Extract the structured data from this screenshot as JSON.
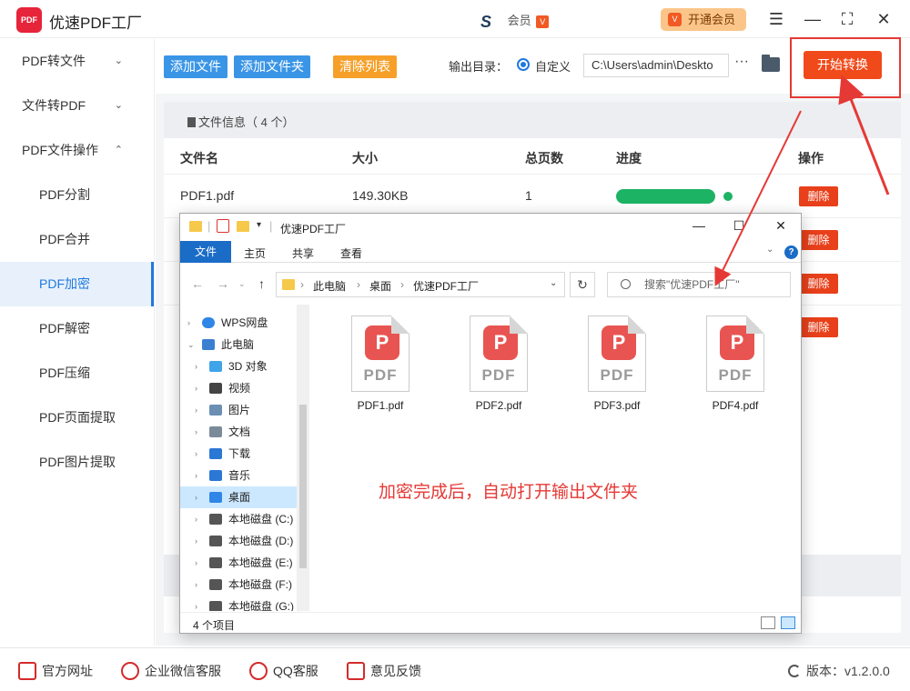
{
  "app": {
    "title": "优速PDF工厂",
    "logo_text": "PDF",
    "account_text": "会员",
    "account_badge": "V",
    "vip_button": "开通会员",
    "vip_icon": "V"
  },
  "window_controls": {
    "menu": "☰",
    "minimize": "—",
    "maximize": "⛶",
    "close": "✕"
  },
  "sidebar": {
    "items": [
      {
        "label": "PDF转文件",
        "chevron": "⌄"
      },
      {
        "label": "文件转PDF",
        "chevron": "⌄"
      },
      {
        "label": "PDF文件操作",
        "chevron": "⌃"
      }
    ],
    "sub_items": [
      "PDF分割",
      "PDF合并",
      "PDF加密",
      "PDF解密",
      "PDF压缩",
      "PDF页面提取",
      "PDF图片提取"
    ],
    "active": "PDF加密"
  },
  "toolbar": {
    "add_file": "添加文件",
    "add_folder": "添加文件夹",
    "clear_list": "清除列表",
    "output_label": "输出目录：",
    "radio_label": "自定义",
    "output_path": "C:\\Users\\admin\\Deskto",
    "more": "···",
    "start_button": "开始转换"
  },
  "file_info": {
    "label": "文件信息（ 4 个）"
  },
  "table": {
    "headers": [
      "文件名",
      "大小",
      "总页数",
      "进度",
      "操作"
    ],
    "rows": [
      {
        "name": "PDF1.pdf",
        "size": "149.30KB",
        "pages": "1",
        "progress": 1.0,
        "action": "删除"
      },
      {
        "name": "",
        "size": "",
        "pages": "",
        "progress": null,
        "action": "删除"
      },
      {
        "name": "",
        "size": "",
        "pages": "",
        "progress": null,
        "action": "删除"
      },
      {
        "name": "",
        "size": "",
        "pages": "",
        "progress": null,
        "action": "删除"
      }
    ]
  },
  "footer": {
    "official_site": "官方网址",
    "wechat_service": "企业微信客服",
    "qq_service": "QQ客服",
    "feedback": "意见反馈",
    "version": "版本：v1.2.0.0"
  },
  "explorer": {
    "title": "优速PDF工厂",
    "ribbon_tabs": [
      "文件",
      "主页",
      "共享",
      "查看"
    ],
    "breadcrumb": [
      "此电脑",
      "桌面",
      "优速PDF工厂"
    ],
    "search_placeholder": "搜索\"优速PDF工厂\"",
    "nav_items": [
      {
        "label": "WPS网盘",
        "icon": "cloud-icon",
        "indent": 0
      },
      {
        "label": "此电脑",
        "icon": "computer-icon",
        "indent": 0
      },
      {
        "label": "3D 对象",
        "icon": "3d-objects-icon",
        "indent": 1
      },
      {
        "label": "视频",
        "icon": "video-icon",
        "indent": 1
      },
      {
        "label": "图片",
        "icon": "pictures-icon",
        "indent": 1
      },
      {
        "label": "文档",
        "icon": "documents-icon",
        "indent": 1
      },
      {
        "label": "下载",
        "icon": "download-icon",
        "indent": 1
      },
      {
        "label": "音乐",
        "icon": "music-icon",
        "indent": 1
      },
      {
        "label": "桌面",
        "icon": "desktop-icon",
        "indent": 1
      },
      {
        "label": "本地磁盘 (C:)",
        "icon": "drive-icon",
        "indent": 1
      },
      {
        "label": "本地磁盘 (D:)",
        "icon": "drive-icon",
        "indent": 1
      },
      {
        "label": "本地磁盘 (E:)",
        "icon": "drive-icon",
        "indent": 1
      },
      {
        "label": "本地磁盘 (F:)",
        "icon": "drive-icon",
        "indent": 1
      },
      {
        "label": "本地磁盘 (G:)",
        "icon": "drive-icon",
        "indent": 1
      }
    ],
    "selected_nav": "桌面",
    "files": [
      "PDF1.pdf",
      "PDF2.pdf",
      "PDF3.pdf",
      "PDF4.pdf"
    ],
    "file_icon_text": "PDF",
    "status": "4 个项目"
  },
  "annotation": "加密完成后，自动打开输出文件夹",
  "colors": {
    "accent_blue": "#1f79df",
    "start_red": "#f04a1a",
    "progress_green": "#1db364",
    "annotation_red": "#e53935"
  }
}
